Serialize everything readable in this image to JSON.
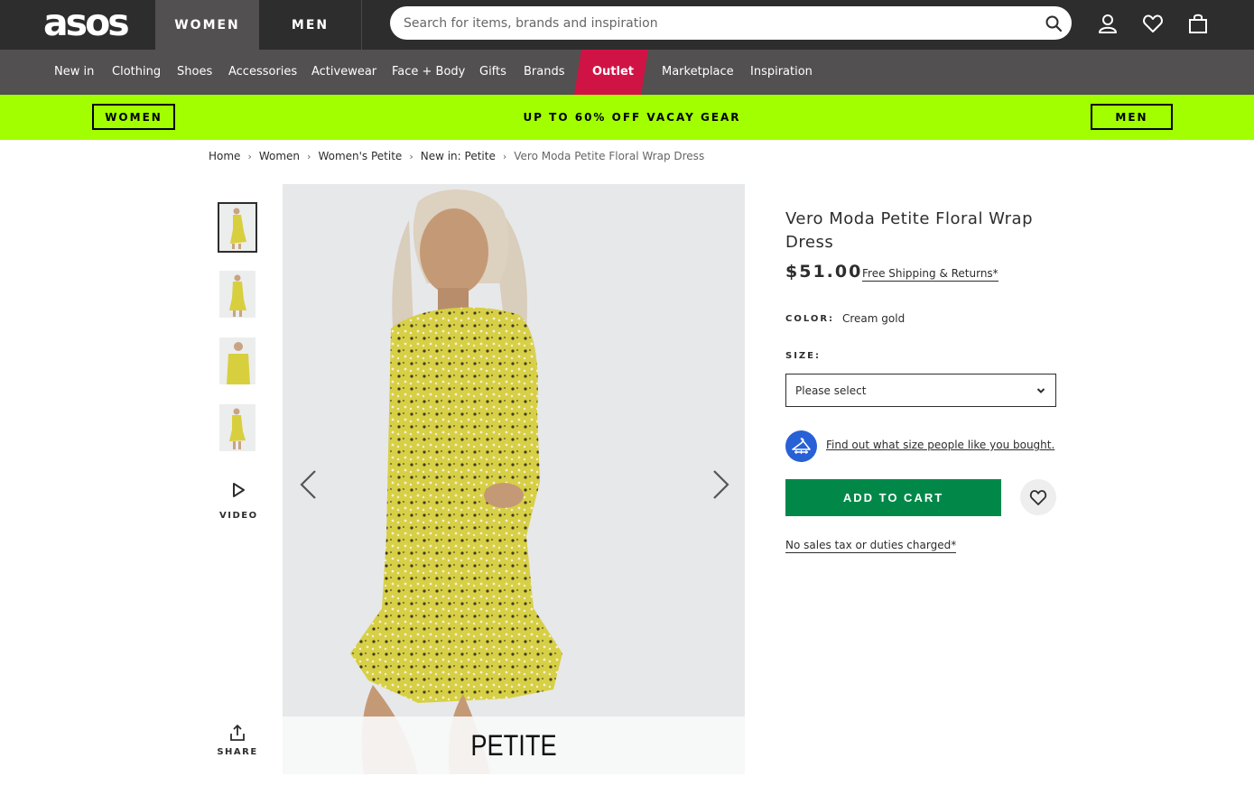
{
  "header": {
    "logo": "asos",
    "tabs": [
      {
        "label": "WOMEN",
        "active": true
      },
      {
        "label": "MEN",
        "active": false
      }
    ],
    "search_placeholder": "Search for items, brands and inspiration",
    "icons": [
      "search-icon",
      "account-icon",
      "heart-icon",
      "bag-icon"
    ]
  },
  "nav": {
    "items": [
      "New in",
      "Clothing",
      "Shoes",
      "Accessories",
      "Activewear",
      "Face + Body",
      "Gifts",
      "Brands",
      "Outlet",
      "Marketplace",
      "Inspiration"
    ],
    "highlight_color": "#d01345"
  },
  "promo": {
    "left_button": "WOMEN",
    "text": "UP TO 60% OFF VACAY GEAR",
    "right_button": "MEN",
    "background": "#a2ff00"
  },
  "breadcrumb": [
    "Home",
    "Women",
    "Women's Petite",
    "New in: Petite",
    "Vero Moda Petite Floral Wrap Dress"
  ],
  "gallery": {
    "video_label": "VIDEO",
    "share_label": "SHARE",
    "overlay_text": "PETITE"
  },
  "product": {
    "title": "Vero Moda Petite Floral Wrap Dress",
    "price": "$51.00",
    "shipping_link": "Free Shipping & Returns*",
    "color_label": "COLOR:",
    "color_value": "Cream gold",
    "size_label": "SIZE:",
    "size_placeholder": "Please select",
    "fit_link": "Find out what size people like you bought.",
    "add_to_cart": "ADD TO CART",
    "tax_note": "No sales tax or duties charged*",
    "cart_color": "#018849"
  }
}
